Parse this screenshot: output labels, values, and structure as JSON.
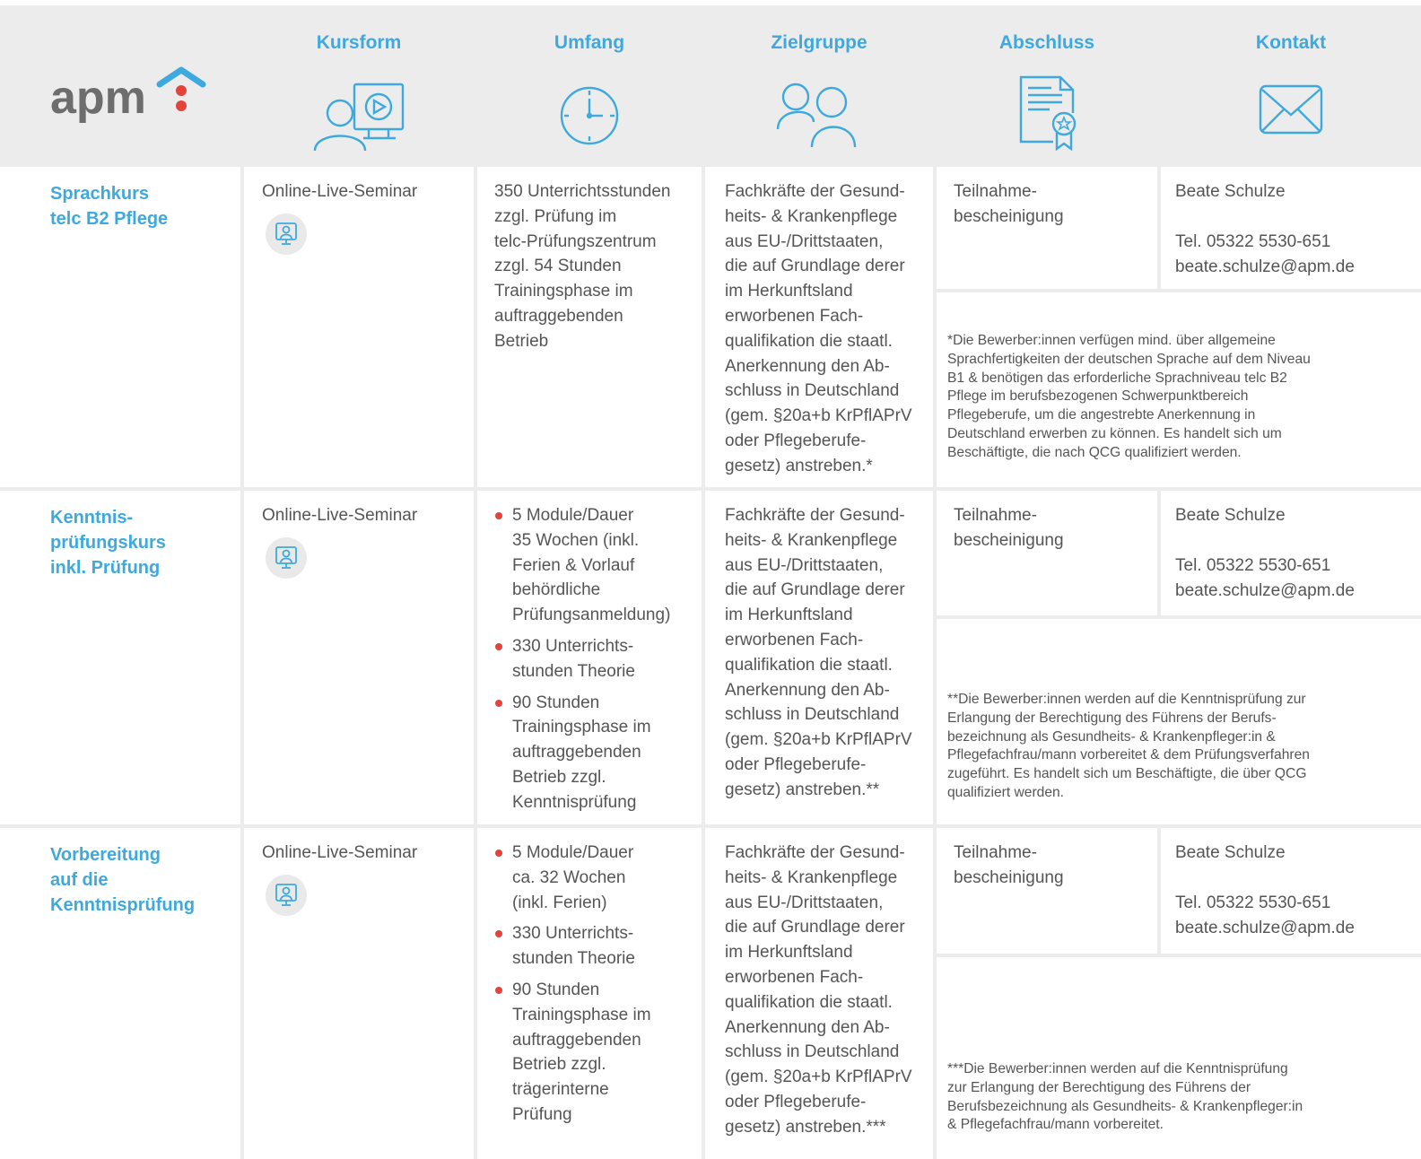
{
  "header": {
    "logo_text": "apm",
    "columns": [
      "Kursform",
      "Umfang",
      "Zielgruppe",
      "Abschluss",
      "Kontakt"
    ]
  },
  "colors": {
    "accent": "#3ea9df",
    "bullet": "#e0443b",
    "grid": "#ececec",
    "logo_dots": "#e0443b"
  },
  "icons": {
    "kursform": "online-seminar-icon",
    "umfang": "clock-icon",
    "zielgruppe": "people-icon",
    "abschluss": "certificate-icon",
    "kontakt": "envelope-icon",
    "row_format": "monitor-person-icon"
  },
  "rows": [
    {
      "title": "Sprachkurs\ntelc B2 Pflege",
      "kursform": "Online-Live-Seminar",
      "umfang": "350 Unterrichtsstunden\nzzgl. Prüfung im\ntelc-Prüfungszentrum\nzzgl. 54 Stunden\nTrainingsphase im\nauftraggebenden\nBetrieb",
      "zielgruppe": "Fachkräfte der Gesund-\nheits- & Krankenpflege\naus EU-/Drittstaaten,\ndie auf Grundlage derer\nim Herkunftsland\nerworbenen Fach-\nqualifikation die staatl.\nAnerkennung den Ab-\nschluss in Deutschland\n(gem. §20a+b KrPflAPrV\noder Pflegeberufe-\ngesetz) anstreben.*",
      "abschluss": "Teilnahme-\nbescheinigung",
      "kontakt_name": "Beate Schulze",
      "kontakt_tel": "Tel. 05322 5530-651",
      "kontakt_mail": "beate.schulze@apm.de",
      "note": "*Die Bewerber:innen verfügen mind. über allgemeine\n Sprachfertigkeiten der deutschen Sprache auf dem Niveau\n B1 & benötigen das erforderliche Sprachniveau telc B2\n Pflege im berufsbezogenen Schwerpunktbereich\n Pflegeberufe, um die angestrebte Anerkennung in\n Deutschland erwerben zu können. Es handelt sich um\n Beschäftigte, die nach QCG qualifiziert werden."
    },
    {
      "title": "Kenntnis-\nprüfungskurs\ninkl. Prüfung",
      "kursform": "Online-Live-Seminar",
      "umfang_items": [
        "5 Module/Dauer\n35 Wochen (inkl.\nFerien & Vorlauf\nbehördliche\nPrüfungsanmeldung)",
        "330 Unterrichts-\nstunden Theorie",
        "90 Stunden\nTrainingsphase im\nauftraggebenden\nBetrieb zzgl.\nKenntnisprüfung"
      ],
      "zielgruppe": "Fachkräfte der Gesund-\nheits- & Krankenpflege\naus EU-/Drittstaaten,\ndie auf Grundlage derer\nim Herkunftsland\nerworbenen Fach-\nqualifikation die staatl.\nAnerkennung den Ab-\nschluss in Deutschland\n(gem. §20a+b KrPflAPrV\noder Pflegeberufe-\ngesetz) anstreben.**",
      "abschluss": "Teilnahme-\nbescheinigung",
      "kontakt_name": "Beate Schulze",
      "kontakt_tel": "Tel. 05322 5530-651",
      "kontakt_mail": "beate.schulze@apm.de",
      "note": "**Die Bewerber:innen werden auf die Kenntnisprüfung zur\n   Erlangung der Berechtigung des Führens der Berufs-\n   bezeichnung als Gesundheits- & Krankenpfleger:in &\n   Pflegefachfrau/mann vorbereitet & dem Prüfungsverfahren\n   zugeführt. Es handelt sich um Beschäftigte, die über QCG\n   qualifiziert werden."
    },
    {
      "title": "Vorbereitung\nauf die\nKenntnisprüfung",
      "kursform": "Online-Live-Seminar",
      "umfang_items": [
        "5 Module/Dauer\nca. 32 Wochen\n(inkl. Ferien)",
        "330 Unterrichts-\nstunden Theorie",
        "90 Stunden\nTrainingsphase im\nauftraggebenden\nBetrieb zzgl.\nträgerinterne\nPrüfung"
      ],
      "zielgruppe": "Fachkräfte der Gesund-\nheits- & Krankenpflege\naus EU-/Drittstaaten,\ndie auf Grundlage derer\nim Herkunftsland\nerworbenen Fach-\nqualifikation die staatl.\nAnerkennung den Ab-\nschluss in Deutschland\n(gem. §20a+b KrPflAPrV\noder Pflegeberufe-\ngesetz) anstreben.***",
      "abschluss": "Teilnahme-\nbescheinigung",
      "kontakt_name": "Beate Schulze",
      "kontakt_tel": "Tel. 05322 5530-651",
      "kontakt_mail": "beate.schulze@apm.de",
      "note": "***Die Bewerber:innen werden auf die Kenntnisprüfung\n    zur Erlangung der Berechtigung des Führens der\n    Berufsbezeichnung als Gesundheits- & Krankenpfleger:in\n    & Pflegefachfrau/mann vorbereitet."
    }
  ]
}
